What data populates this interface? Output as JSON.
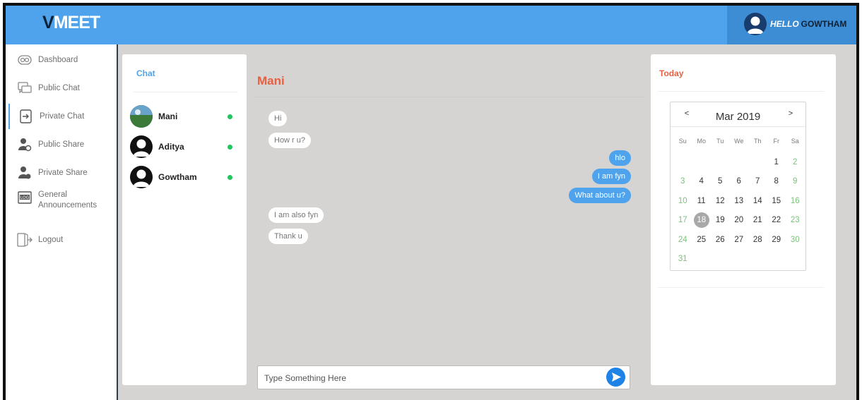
{
  "header": {
    "brand_first": "V",
    "brand_rest": "MEET",
    "hello_label": "HELLO",
    "user_name": "GOWTHAM"
  },
  "sidebar": {
    "items": [
      {
        "label": "Dashboard",
        "icon": "dashboard-icon"
      },
      {
        "label": "Public Chat",
        "icon": "chat-icon"
      },
      {
        "label": "Private Chat",
        "icon": "enter-icon",
        "active": true
      },
      {
        "label": "Public Share",
        "icon": "user-share-icon"
      },
      {
        "label": "Private Share",
        "icon": "user-share-icon"
      },
      {
        "label_line1": "General",
        "label_line2": "Announcements",
        "icon": "log-icon"
      },
      {
        "label": "Logout",
        "icon": "logout-icon"
      }
    ]
  },
  "chat_list": {
    "title": "Chat",
    "contacts": [
      {
        "name": "Mani",
        "online": true
      },
      {
        "name": "Aditya",
        "online": true
      },
      {
        "name": "Gowtham",
        "online": true
      }
    ]
  },
  "conversation": {
    "contact_name": "Mani",
    "messages": [
      {
        "text": "Hi",
        "direction": "in"
      },
      {
        "text": "How r u?",
        "direction": "in"
      },
      {
        "text": "hlo",
        "direction": "out"
      },
      {
        "text": "I am fyn",
        "direction": "out"
      },
      {
        "text": "What about u?",
        "direction": "out"
      },
      {
        "text": "I am also fyn",
        "direction": "in"
      },
      {
        "text": "Thank u",
        "direction": "in"
      }
    ],
    "input_placeholder": "Type Something Here"
  },
  "calendar": {
    "heading": "Today",
    "month_label": "Mar 2019",
    "prev": "<",
    "next": ">",
    "weekdays": [
      "Su",
      "Mo",
      "Tu",
      "We",
      "Th",
      "Fr",
      "Sa"
    ],
    "first_weekday_index": 5,
    "days_in_month": 31,
    "selected_day": 18
  },
  "colors": {
    "accent": "#4fa3ec",
    "name_orange": "#e8603f",
    "online_green": "#22c55e",
    "weekend_green": "#7cc27c"
  }
}
